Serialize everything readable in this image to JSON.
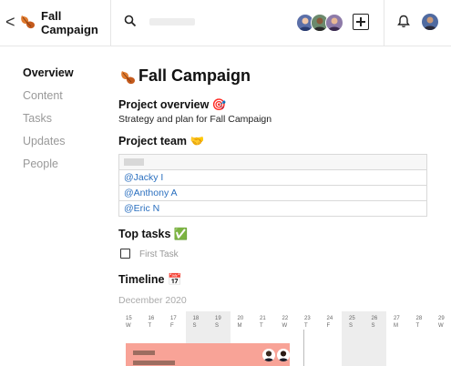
{
  "header": {
    "back_label": "<",
    "project_title_line1": "Fall",
    "project_title_line2": "Campaign",
    "search_icon": "search-icon",
    "add_icon": "plus-square-icon",
    "bell_icon": "bell-icon"
  },
  "sidebar": {
    "items": [
      {
        "label": "Overview",
        "active": true
      },
      {
        "label": "Content",
        "active": false
      },
      {
        "label": "Tasks",
        "active": false
      },
      {
        "label": "Updates",
        "active": false
      },
      {
        "label": "People",
        "active": false
      }
    ]
  },
  "main": {
    "title": "Fall Campaign",
    "overview": {
      "heading": "Project overview",
      "heading_emoji": "🎯",
      "text": "Strategy and plan for Fall Campaign"
    },
    "team": {
      "heading": "Project team",
      "heading_emoji": "🤝",
      "members": [
        "@Jacky I",
        "@Anthony A",
        "@Eric N"
      ]
    },
    "tasks": {
      "heading": "Top tasks",
      "heading_emoji": "✅",
      "items": [
        {
          "label": "First Task",
          "done": false
        }
      ]
    },
    "timeline": {
      "heading": "Timeline",
      "heading_emoji": "📅",
      "month": "December 2020",
      "days": [
        {
          "n": "15",
          "d": "W"
        },
        {
          "n": "16",
          "d": "T"
        },
        {
          "n": "17",
          "d": "F"
        },
        {
          "n": "18",
          "d": "S"
        },
        {
          "n": "19",
          "d": "S"
        },
        {
          "n": "20",
          "d": "M"
        },
        {
          "n": "21",
          "d": "T"
        },
        {
          "n": "22",
          "d": "W"
        },
        {
          "n": "23",
          "d": "T"
        },
        {
          "n": "24",
          "d": "F"
        },
        {
          "n": "25",
          "d": "S"
        },
        {
          "n": "26",
          "d": "S"
        },
        {
          "n": "27",
          "d": "M"
        },
        {
          "n": "28",
          "d": "T"
        },
        {
          "n": "29",
          "d": "W"
        }
      ]
    }
  },
  "colors": {
    "accent_link": "#2a6fbf",
    "timeline_bar": "#f8a397",
    "leaf_orange": "#e07a2e"
  }
}
